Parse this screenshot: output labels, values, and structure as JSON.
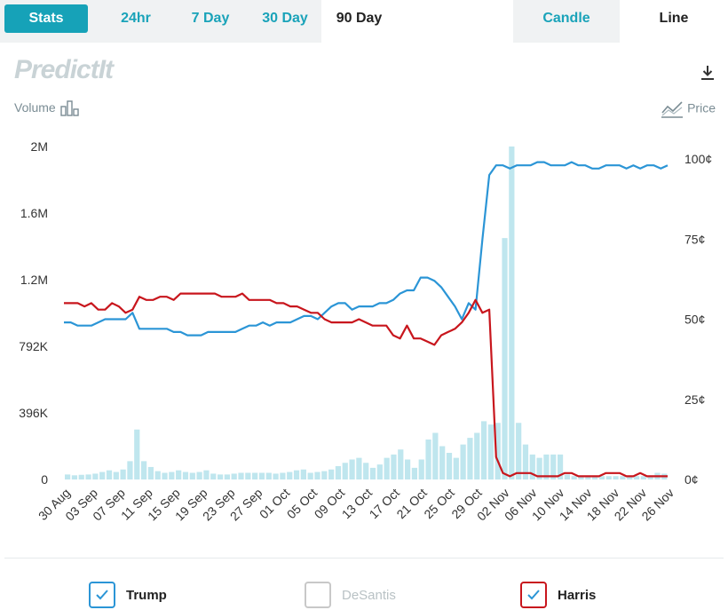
{
  "tabs": {
    "stats": "Stats",
    "ranges": [
      "24hr",
      "7 Day",
      "30 Day",
      "90 Day"
    ],
    "active_range": "90 Day",
    "views": [
      "Candle",
      "Line"
    ],
    "active_view": "Line"
  },
  "logo_text": "PredictIt",
  "volume_legend": "Volume",
  "price_legend": "Price",
  "legend": [
    {
      "name": "Trump",
      "checked": true,
      "color": "#2b95d6"
    },
    {
      "name": "DeSantis",
      "checked": false,
      "color": "#c8c8c8"
    },
    {
      "name": "Harris",
      "checked": true,
      "color": "#c8161d"
    }
  ],
  "chart_data": {
    "type": "line",
    "left_axis": {
      "label": "Volume",
      "ticks": [
        "0",
        "396K",
        "792K",
        "1.2M",
        "1.6M",
        "2M"
      ],
      "ylim": [
        0,
        2000000
      ]
    },
    "right_axis": {
      "label": "Price",
      "ticks": [
        "0¢",
        "25¢",
        "50¢",
        "75¢",
        "100¢"
      ],
      "ylim": [
        0,
        100
      ]
    },
    "x_tick_labels": [
      "30 Aug",
      "03 Sep",
      "07 Sep",
      "11 Sep",
      "15 Sep",
      "19 Sep",
      "23 Sep",
      "27 Sep",
      "01 Oct",
      "05 Oct",
      "09 Oct",
      "13 Oct",
      "17 Oct",
      "21 Oct",
      "25 Oct",
      "29 Oct",
      "02 Nov",
      "06 Nov",
      "10 Nov",
      "14 Nov",
      "18 Nov",
      "22 Nov",
      "26 Nov"
    ],
    "volume": [
      30000,
      25000,
      28000,
      30000,
      35000,
      45000,
      55000,
      45000,
      60000,
      110000,
      300000,
      110000,
      75000,
      50000,
      40000,
      45000,
      55000,
      45000,
      40000,
      45000,
      55000,
      35000,
      30000,
      30000,
      35000,
      40000,
      40000,
      40000,
      40000,
      40000,
      35000,
      40000,
      45000,
      55000,
      60000,
      40000,
      45000,
      50000,
      60000,
      80000,
      100000,
      120000,
      130000,
      100000,
      70000,
      90000,
      130000,
      150000,
      180000,
      120000,
      70000,
      120000,
      240000,
      280000,
      200000,
      160000,
      130000,
      210000,
      250000,
      280000,
      350000,
      330000,
      340000,
      1450000,
      2000000,
      340000,
      210000,
      150000,
      130000,
      150000,
      150000,
      150000,
      30000,
      20000,
      20000,
      20000,
      20000,
      20000,
      20000,
      20000,
      20000,
      20000,
      20000,
      20000,
      20000,
      40000,
      35000
    ],
    "series": [
      {
        "name": "Trump",
        "color": "#2b95d6",
        "values": [
          49,
          49,
          48,
          48,
          48,
          49,
          50,
          50,
          50,
          50,
          52,
          47,
          47,
          47,
          47,
          47,
          46,
          46,
          45,
          45,
          45,
          46,
          46,
          46,
          46,
          46,
          47,
          48,
          48,
          49,
          48,
          49,
          49,
          49,
          50,
          51,
          51,
          50,
          52,
          54,
          55,
          55,
          53,
          54,
          54,
          54,
          55,
          55,
          56,
          58,
          59,
          59,
          63,
          63,
          62,
          60,
          57,
          54,
          50,
          55,
          53,
          75,
          95,
          98,
          98,
          97,
          98,
          98,
          98,
          99,
          99,
          98,
          98,
          98,
          99,
          98,
          98,
          97,
          97,
          98,
          98,
          98,
          97,
          98,
          97,
          98,
          98,
          97,
          98
        ]
      },
      {
        "name": "Harris",
        "color": "#c8161d",
        "values": [
          55,
          55,
          55,
          54,
          55,
          53,
          53,
          55,
          54,
          52,
          53,
          57,
          56,
          56,
          57,
          57,
          56,
          58,
          58,
          58,
          58,
          58,
          58,
          57,
          57,
          57,
          58,
          56,
          56,
          56,
          56,
          55,
          55,
          54,
          54,
          53,
          52,
          52,
          50,
          49,
          49,
          49,
          49,
          50,
          49,
          48,
          48,
          48,
          45,
          44,
          48,
          44,
          44,
          43,
          42,
          45,
          46,
          47,
          49,
          52,
          56,
          52,
          53,
          7,
          2,
          1,
          2,
          2,
          2,
          1,
          1,
          1,
          1,
          2,
          2,
          1,
          1,
          1,
          1,
          2,
          2,
          2,
          1,
          1,
          2,
          1,
          1,
          1,
          1
        ]
      },
      {
        "name": "DeSantis",
        "color": "#c8c8c8",
        "values": []
      }
    ]
  }
}
